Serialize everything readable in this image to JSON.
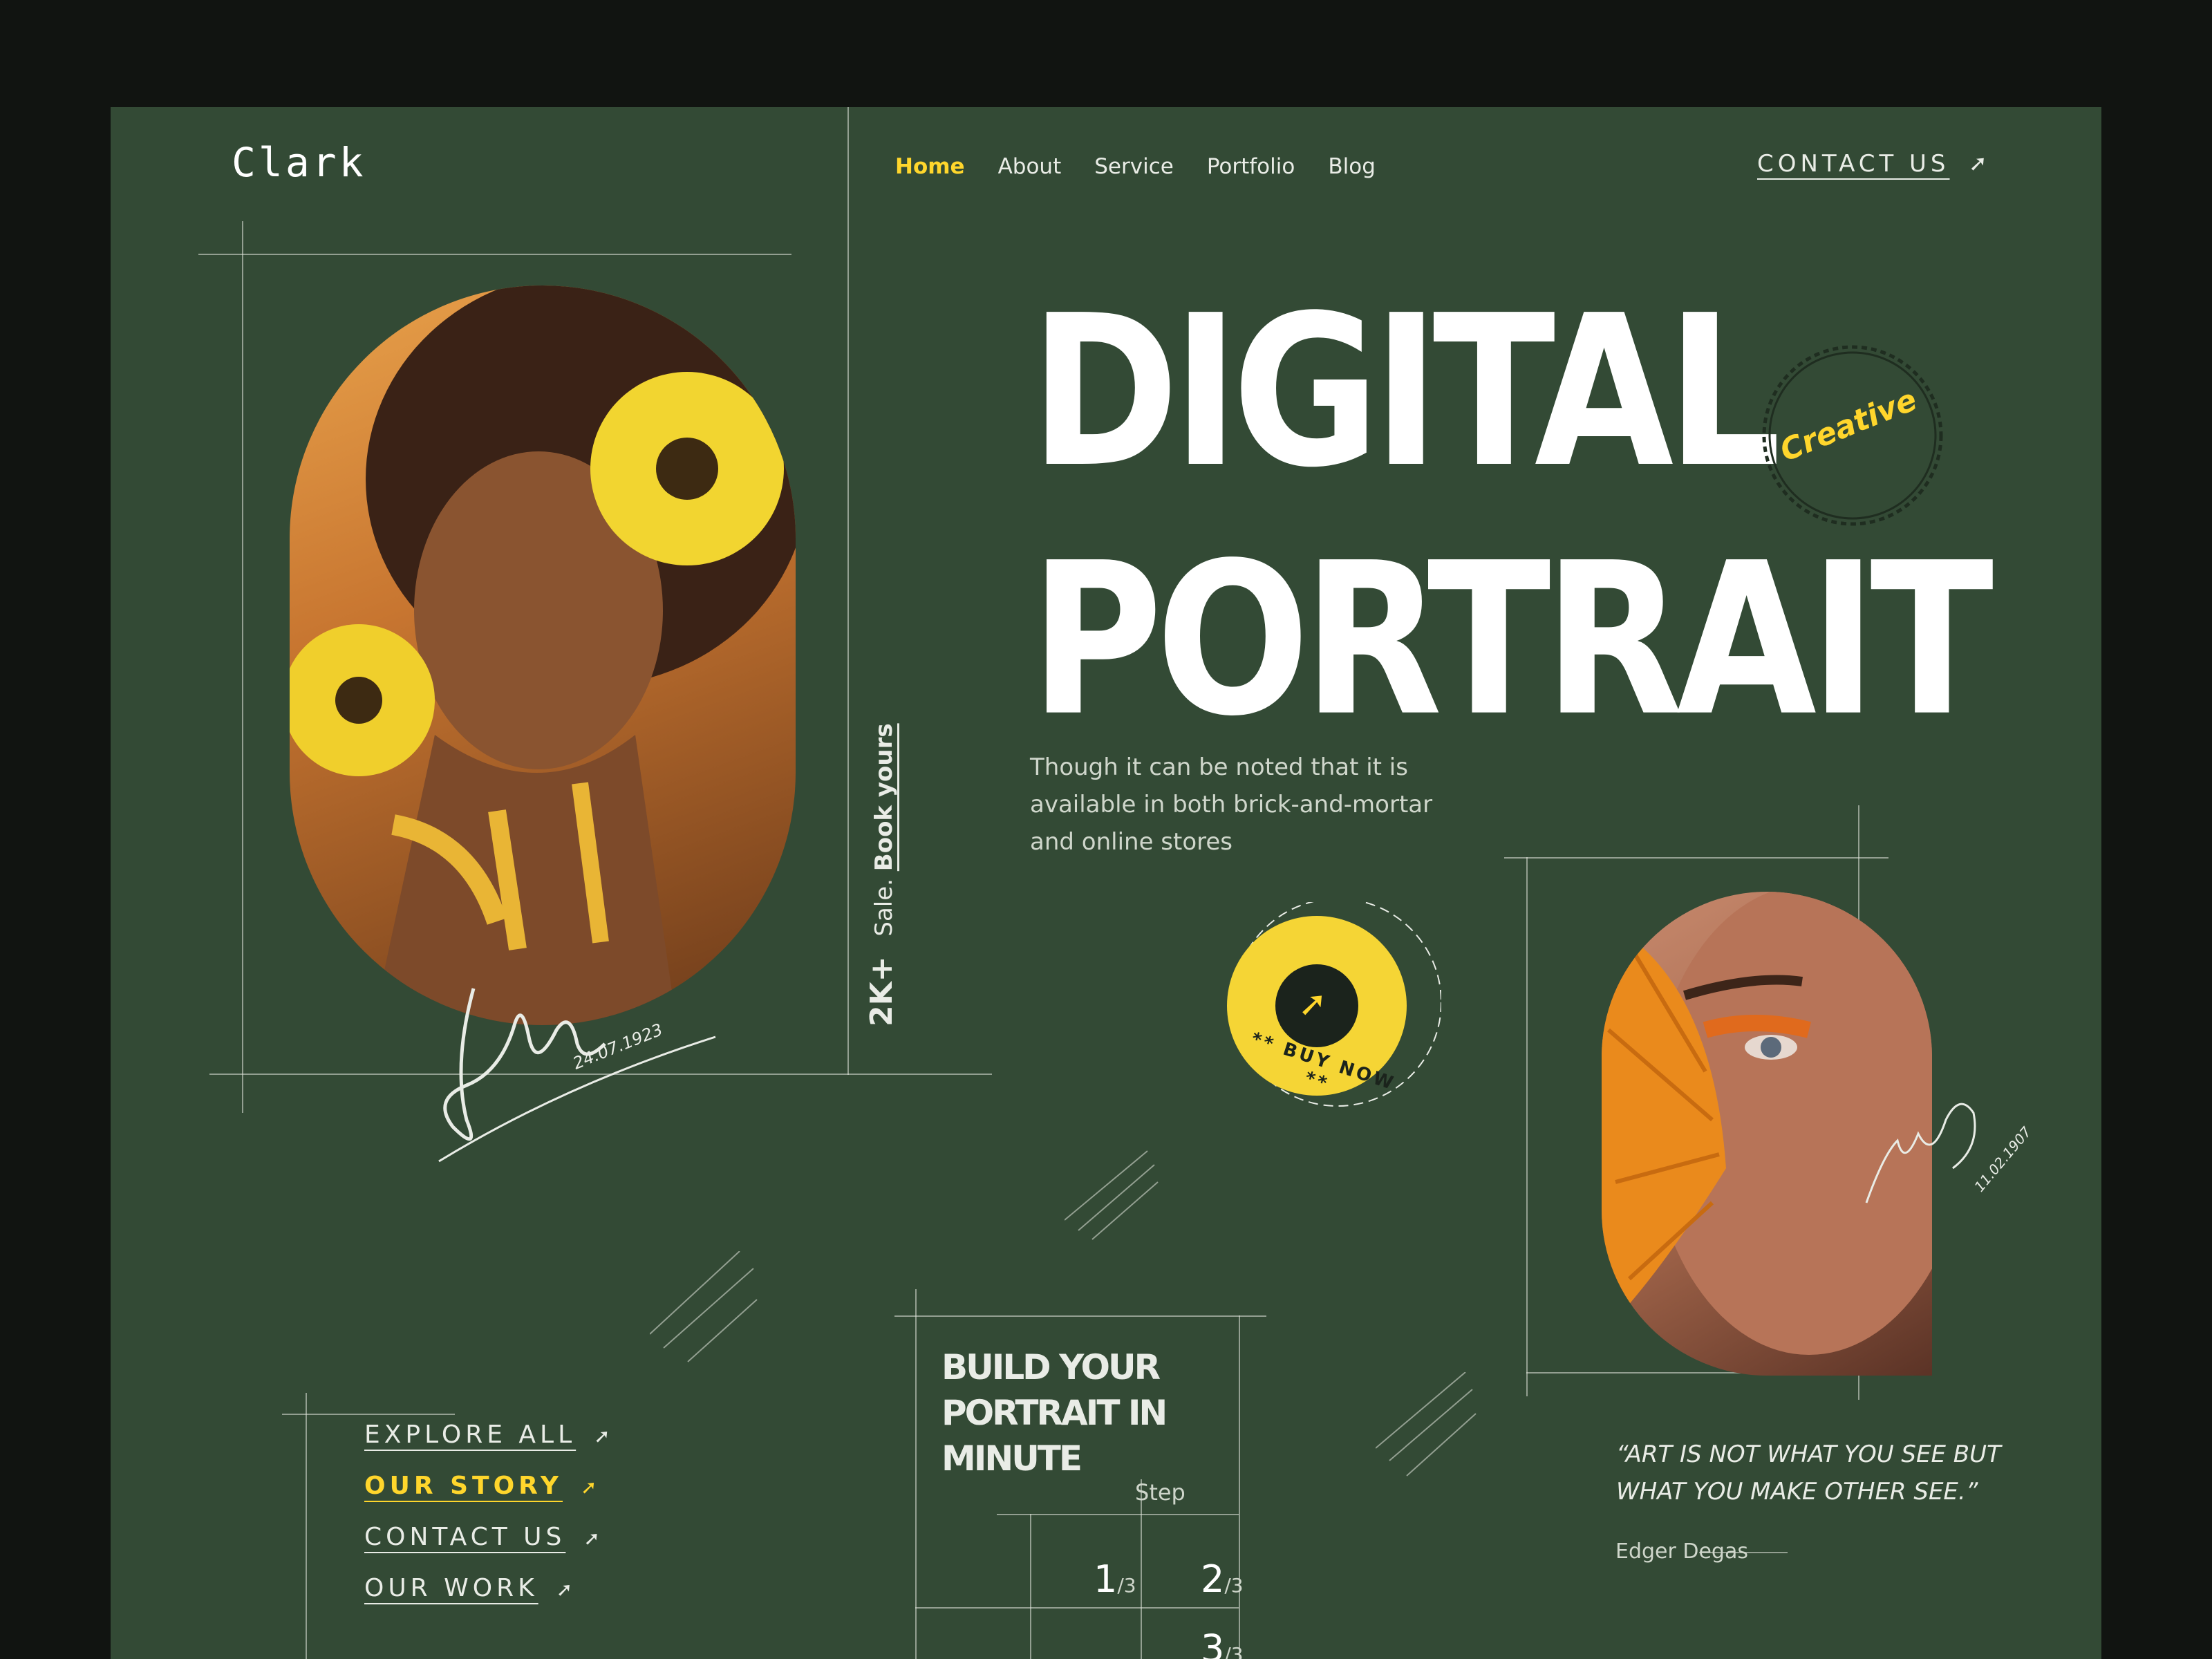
{
  "brand": {
    "logo": "Clark"
  },
  "nav": {
    "items": [
      {
        "label": "Home",
        "active": true
      },
      {
        "label": "About",
        "active": false
      },
      {
        "label": "Service",
        "active": false
      },
      {
        "label": "Portfolio",
        "active": false
      },
      {
        "label": "Blog",
        "active": false
      }
    ],
    "contact_label": "CONTACT US"
  },
  "hero": {
    "title_line1": "DIGITAL",
    "title_line2": "PORTRAIT",
    "badge_text": "Creative",
    "description": "Though it can be noted that it is available in both brick-and-mortar and online stores"
  },
  "sale": {
    "count": "2K+",
    "label": "Sale.",
    "cta": "Book yours"
  },
  "buy_badge": {
    "text": "** BUY NOW **"
  },
  "signatures": {
    "left_date": "24.07.1923",
    "right_date": "11.02.1907"
  },
  "side_links": [
    {
      "label": "EXPLORE ALL",
      "active": false
    },
    {
      "label": "OUR STORY",
      "active": true
    },
    {
      "label": "CONTACT US",
      "active": false
    },
    {
      "label": "OUR WORK",
      "active": false
    }
  ],
  "build": {
    "title": "BUILD YOUR PORTRAIT IN MINUTE",
    "step_label": "Step",
    "steps": [
      {
        "num": "1",
        "total": "/3"
      },
      {
        "num": "2",
        "total": "/3"
      },
      {
        "num": "3",
        "total": "/3"
      }
    ]
  },
  "quote": {
    "text": "“ART IS NOT WHAT YOU SEE BUT WHAT YOU MAKE OTHER SEE.”",
    "author": "Edger Degas"
  },
  "colors": {
    "background": "#111411",
    "panel": "#334a35",
    "accent": "#ffd62c",
    "text": "#e9ece6"
  },
  "icons": {
    "nav_arrow": "arrow-up-right-icon",
    "buy_arrow": "arrow-up-right-icon"
  }
}
